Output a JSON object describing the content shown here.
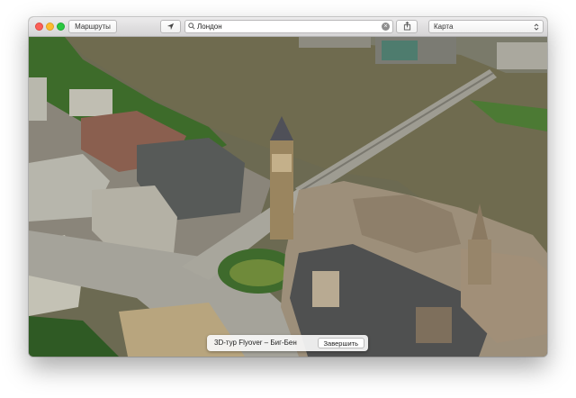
{
  "toolbar": {
    "routes_label": "Маршруты",
    "search": {
      "value": "Лондон",
      "placeholder": ""
    },
    "map_type": {
      "selected": "Карта"
    },
    "icons": [
      "location-arrow-icon",
      "search-icon",
      "clear-icon",
      "share-icon",
      "chevron-down-icon"
    ]
  },
  "flyover": {
    "title": "3D-тур Flyover – Биг-Бен",
    "end_label": "Завершить"
  },
  "colors": {
    "river": "#6f6b4f",
    "park": "#3d6b2a",
    "stone": "#9d8f7a",
    "roof": "#4f5050",
    "road": "#a5a39a"
  }
}
